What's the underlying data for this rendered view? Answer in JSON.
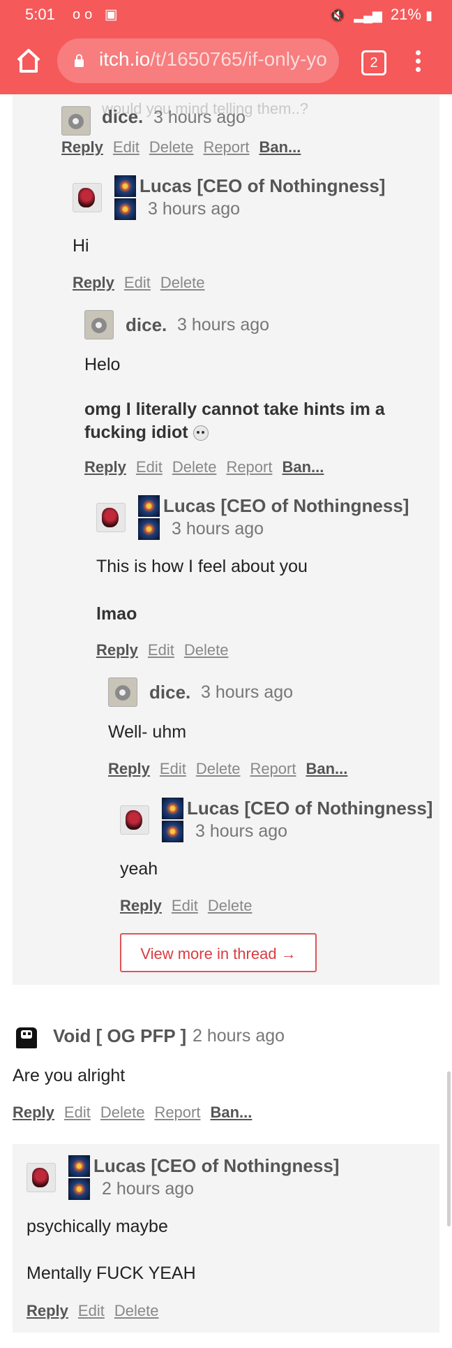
{
  "status_bar": {
    "time": "5:01",
    "left_icons": "oo ▣",
    "battery_percent": "21%"
  },
  "browser": {
    "url_host": "itch.io",
    "url_path": "/t/1650765/if-only-yo",
    "tab_count": "2"
  },
  "ghost_text": "would you mind telling them..?",
  "comments": [
    {
      "user": "dice.",
      "time": "3 hours ago",
      "reply": "Reply",
      "edit": "Edit",
      "delete": "Delete",
      "report": "Report",
      "ban": "Ban..."
    },
    {
      "user": "Lucas [CEO of Nothingness]",
      "time": "3 hours ago",
      "text": "Hi",
      "reply": "Reply",
      "edit": "Edit",
      "delete": "Delete"
    },
    {
      "user": "dice.",
      "time": "3 hours ago",
      "text": "Helo",
      "bold_line1": "omg I literally cannot take hints im a",
      "bold_line2": "fucking idiot",
      "reply": "Reply",
      "edit": "Edit",
      "delete": "Delete",
      "report": "Report",
      "ban": "Ban..."
    },
    {
      "user": "Lucas [CEO of Nothingness]",
      "time": "3 hours ago",
      "text": "This is how I feel about you",
      "bold": "lmao",
      "reply": "Reply",
      "edit": "Edit",
      "delete": "Delete"
    },
    {
      "user": "dice.",
      "time": "3 hours ago",
      "text": "Well- uhm",
      "reply": "Reply",
      "edit": "Edit",
      "delete": "Delete",
      "report": "Report",
      "ban": "Ban..."
    },
    {
      "user": "Lucas [CEO of Nothingness]",
      "time": "3 hours ago",
      "text": "yeah",
      "reply": "Reply",
      "edit": "Edit",
      "delete": "Delete"
    },
    {
      "user": "Void [ OG PFP ]",
      "time": "2 hours ago",
      "text": "Are you alright",
      "reply": "Reply",
      "edit": "Edit",
      "delete": "Delete",
      "report": "Report",
      "ban": "Ban..."
    },
    {
      "user": "Lucas [CEO of Nothingness]",
      "time": "2 hours ago",
      "text": "psychically maybe",
      "text2": "Mentally FUCK YEAH",
      "reply": "Reply",
      "edit": "Edit",
      "delete": "Delete"
    }
  ],
  "view_more": "View more in thread →",
  "colors": {
    "chrome": "#f5595a",
    "thread_bg": "#f4f4f4",
    "accent": "#da3b40"
  }
}
